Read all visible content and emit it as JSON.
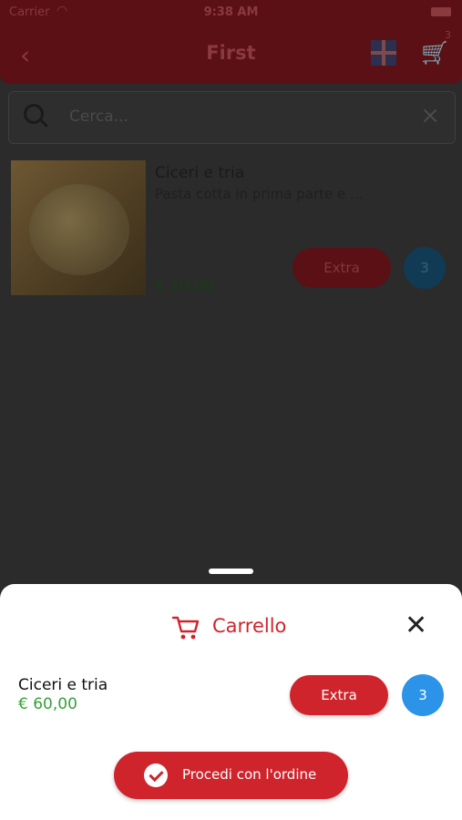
{
  "status_bar": {
    "carrier": "Carrier",
    "time": "9:38 AM"
  },
  "nav": {
    "title": "First",
    "cart_count": "3"
  },
  "search": {
    "placeholder": "Cerca..."
  },
  "product": {
    "name": "Ciceri e tria",
    "description": "Pasta cotta in prima parte e ...",
    "price": "€ 20,00",
    "extra_label": "Extra",
    "quantity": "3"
  },
  "cart_sheet": {
    "title": "Carrello",
    "item": {
      "name": "Ciceri e tria",
      "price": "€ 60,00",
      "extra_label": "Extra",
      "quantity": "3"
    },
    "order_button_label": "Procedi con l'ordine"
  },
  "colors": {
    "accent": "#d0242c",
    "price_green": "#36a03a",
    "qty_blue": "#2c94e8"
  }
}
